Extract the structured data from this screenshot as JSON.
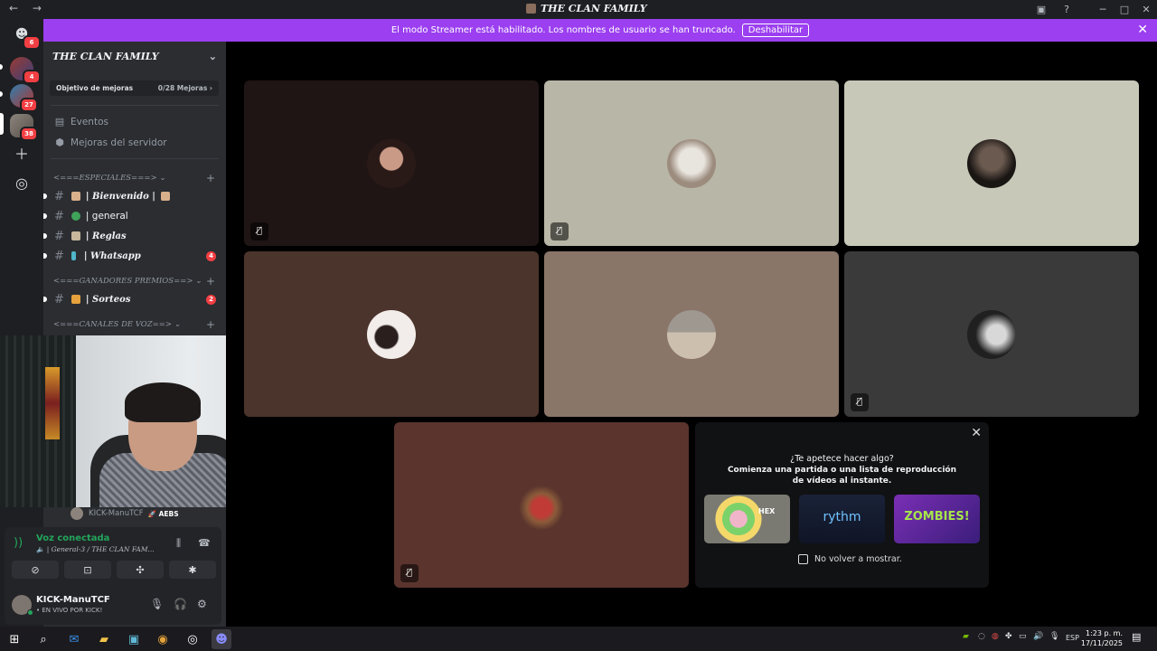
{
  "window": {
    "title": "THE CLAN FAMILY",
    "back": "←",
    "forward": "→"
  },
  "banner": {
    "message": "El modo Streamer está habilitado. Los nombres de usuario se han truncado.",
    "button": "Deshabilitar"
  },
  "rail": {
    "badges": [
      "6",
      "4",
      "27",
      "38"
    ]
  },
  "server": {
    "name": "THE CLAN FAMILY",
    "boost_label": "Objetivo de mejoras",
    "boost_progress": "0/28 Mejoras",
    "links": [
      "Eventos",
      "Mejoras del servidor"
    ]
  },
  "categories": [
    "<===ESPECIALES===>",
    "<===GANADORES PREMIOS==>",
    "<===CANALES DE VOZ==>"
  ],
  "channels": [
    {
      "name": "| Bienvenido |",
      "count": ""
    },
    {
      "name": "| general",
      "count": ""
    },
    {
      "name": "| Reglas",
      "count": ""
    },
    {
      "name": "| Whatsapp",
      "count": "4"
    },
    {
      "name": "| Sorteos",
      "count": "2"
    }
  ],
  "webcam": {
    "user": "KICK-ManuTCF",
    "tag": "AEBS"
  },
  "voice": {
    "status": "Voz conectada",
    "channel": "| General-3 / THE CLAN FAM..."
  },
  "user": {
    "name": "KICK-ManuTCF",
    "status": "• EN VIVO POR KICK!"
  },
  "activity": {
    "title": "¿Te apetece hacer algo?",
    "body": "Comienza una partida o una lista de reproducción de vídeos al instante.",
    "cards": [
      "HEX",
      "rythm",
      "ZOMBIES!"
    ],
    "checkbox": "No volver a mostrar."
  },
  "taskbar": {
    "lang": "ESP",
    "time": "1:23 p. m.",
    "date": "17/11/2025"
  },
  "colors": {
    "accent": "#9b3ff0",
    "online": "#23a55a",
    "badge": "#f23f43"
  }
}
